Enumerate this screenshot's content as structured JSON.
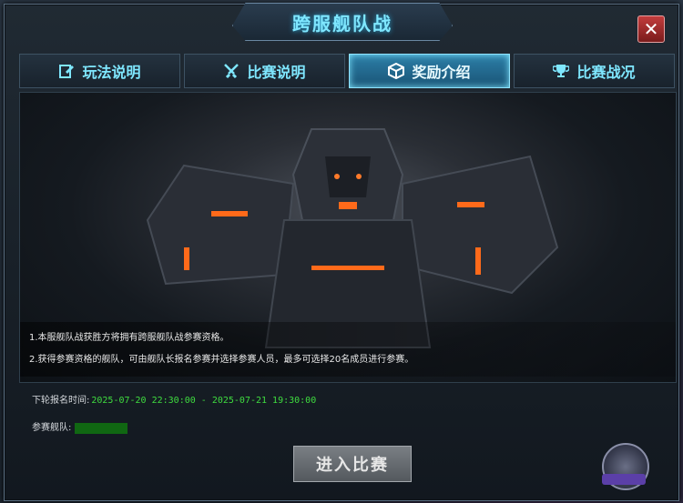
{
  "title": "跨服舰队战",
  "close_label": "✕",
  "tabs": [
    {
      "label": "玩法说明",
      "icon": "edit-icon",
      "active": false
    },
    {
      "label": "比赛说明",
      "icon": "swords-icon",
      "active": false
    },
    {
      "label": "奖励介绍",
      "icon": "box-icon",
      "active": true
    },
    {
      "label": "比赛战况",
      "icon": "trophy-icon",
      "active": false
    }
  ],
  "description": [
    "1.本服舰队战获胜方将拥有跨服舰队战参赛资格。",
    "2.获得参赛资格的舰队，可由舰队长报名参赛并选择参赛人员，最多可选择20名成员进行参赛。"
  ],
  "info": {
    "next_signup_label": "下轮报名时间:",
    "next_signup_value": "2025-07-20 22:30:00 - 2025-07-21 19:30:00",
    "team_label": "参赛舰队:"
  },
  "enter_button": "进入比赛",
  "colors": {
    "accent": "#7fe7ff",
    "active_tab": "#2c7fa8",
    "time_text": "#3fdc3f",
    "close": "#c23c3c"
  }
}
